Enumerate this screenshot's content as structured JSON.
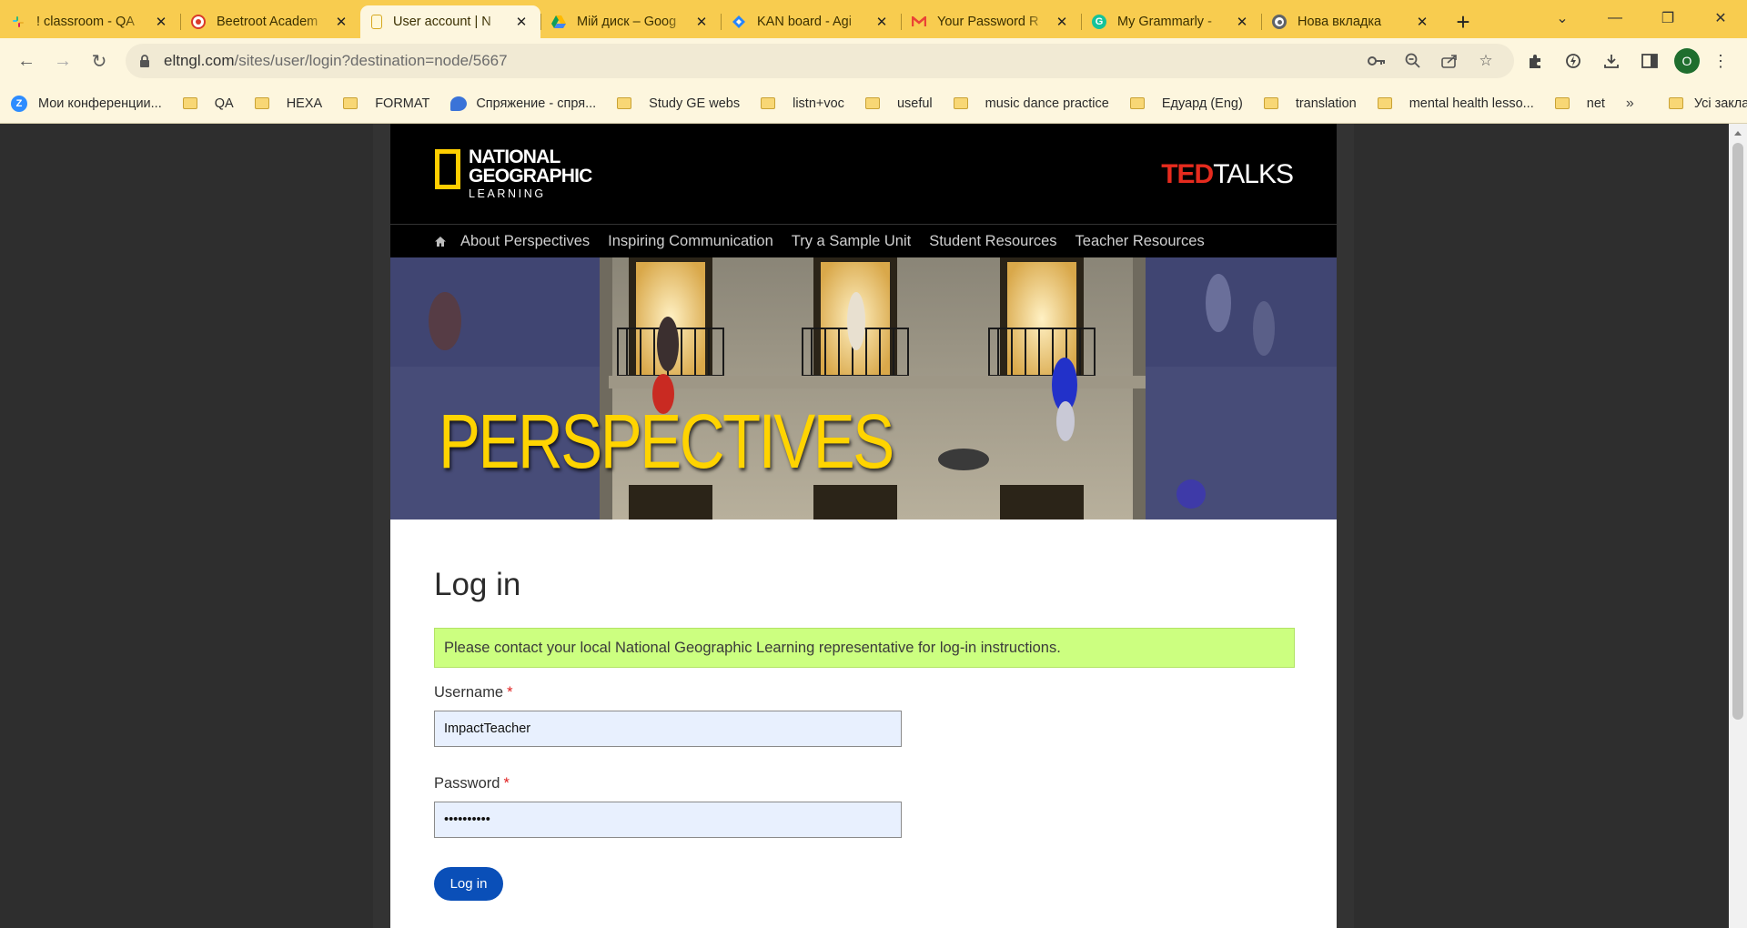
{
  "browser": {
    "tabs": [
      {
        "title": "! classroom - QA",
        "icon": "slack-icon",
        "color": "#e01e5a"
      },
      {
        "title": "Beetroot Academ",
        "icon": "beetroot-icon",
        "color": "#d93a2b"
      },
      {
        "title": "User account | N",
        "icon": "page-icon",
        "color": "#f8d775",
        "active": true
      },
      {
        "title": "Мій диск – Goog",
        "icon": "google-drive-icon",
        "color": "#1fa463"
      },
      {
        "title": "KAN board - Agi",
        "icon": "jira-icon",
        "color": "#2684ff"
      },
      {
        "title": "Your Password R",
        "icon": "gmail-icon",
        "color": "#ea4335"
      },
      {
        "title": "My Grammarly -",
        "icon": "grammarly-icon",
        "color": "#15c39a"
      },
      {
        "title": "Нова вкладка",
        "icon": "chrome-icon",
        "color": "#5f6368"
      }
    ],
    "new_tab": "+",
    "url_host": "eltngl.com",
    "url_path": "/sites/user/login?destination=node/5667",
    "profile_initial": "O",
    "bookmarks": [
      {
        "label": "Мои конференции...",
        "icon": "zoom-icon"
      },
      {
        "label": "QA",
        "icon": "folder-icon"
      },
      {
        "label": "HEXA",
        "icon": "folder-icon"
      },
      {
        "label": "FORMAT",
        "icon": "folder-icon"
      },
      {
        "label": "Спряжение - спря...",
        "icon": "chat-bubble-icon"
      },
      {
        "label": "Study GE webs",
        "icon": "folder-icon"
      },
      {
        "label": "listn+voc",
        "icon": "folder-icon"
      },
      {
        "label": "useful",
        "icon": "folder-icon"
      },
      {
        "label": "music dance practice",
        "icon": "folder-icon"
      },
      {
        "label": "Едуард (Eng)",
        "icon": "folder-icon"
      },
      {
        "label": "translation",
        "icon": "folder-icon"
      },
      {
        "label": "mental health lesso...",
        "icon": "folder-icon"
      },
      {
        "label": "net",
        "icon": "folder-icon"
      }
    ],
    "bookmarks_more": "»",
    "all_bookmarks": "Усі закладки"
  },
  "site": {
    "logo_line1": "NATIONAL",
    "logo_line2": "GEOGRAPHIC",
    "logo_line3": "LEARNING",
    "ted_red": "TED",
    "ted_white": "TALKS",
    "nav": [
      "About Perspectives",
      "Inspiring Communication",
      "Try a Sample Unit",
      "Student Resources",
      "Teacher Resources"
    ],
    "hero_title": "PERSPECTIVES",
    "accent_yellow": "#ffd400",
    "ted_red_color": "#e62b1e"
  },
  "login": {
    "title": "Log in",
    "status_message": "Please contact your local National Geographic Learning representative for log-in instructions.",
    "username_label": "Username",
    "username_value": "ImpactTeacher",
    "password_label": "Password",
    "password_value": "••••••••••",
    "required_marker": "*",
    "submit_label": "Log in",
    "button_color": "#0a4fb8",
    "status_color": "#ccff80"
  }
}
